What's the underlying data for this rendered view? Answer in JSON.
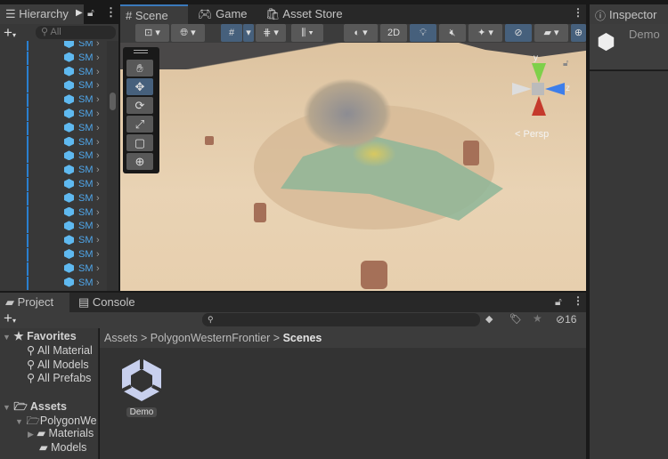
{
  "hierarchy": {
    "title": "Hierarchy",
    "search_placeholder": "All",
    "item_label": "SM",
    "item_count": 18
  },
  "scene_tabs": [
    {
      "label": "Scene",
      "icon": "hash-icon",
      "active": true
    },
    {
      "label": "Game",
      "icon": "gamepad-icon"
    },
    {
      "label": "Asset Store",
      "icon": "shopping-bag-icon"
    }
  ],
  "scene_toolbar": {
    "mode_2d": "2D",
    "persp_label": "< Persp",
    "gizmo_axes": {
      "y": "y",
      "z": "z"
    }
  },
  "tools": [
    "hand-icon",
    "move-icon",
    "rotate-icon",
    "scale-icon",
    "rect-icon",
    "transform-icon"
  ],
  "inspector": {
    "title": "Inspector",
    "object_name": "Demo"
  },
  "project": {
    "tabs": [
      {
        "label": "Project",
        "active": true
      },
      {
        "label": "Console"
      }
    ],
    "hidden_count": "16",
    "favorites": {
      "label": "Favorites",
      "items": [
        "All Material",
        "All Models",
        "All Prefabs"
      ]
    },
    "assets": {
      "label": "Assets",
      "children": [
        "PolygonWe",
        "Materials",
        "Models"
      ]
    },
    "breadcrumb": [
      "Assets",
      "PolygonWesternFrontier",
      "Scenes"
    ],
    "files": [
      {
        "name": "Demo",
        "icon": "unity-scene-icon"
      }
    ]
  },
  "colors": {
    "accent": "#3a79bb",
    "selected_button": "#46607c",
    "hierarchy_item": "#4fa6ea"
  }
}
